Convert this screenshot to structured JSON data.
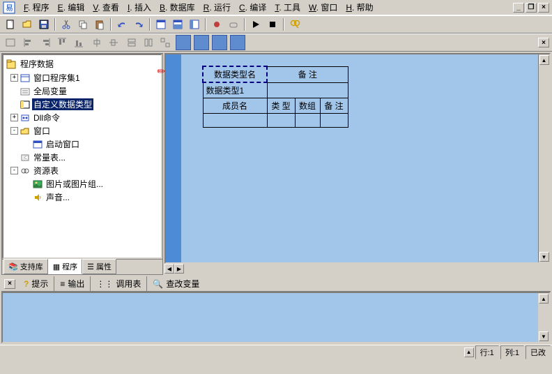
{
  "menu": {
    "items": [
      {
        "key": "F",
        "label": ". 程序"
      },
      {
        "key": "E",
        "label": ". 编辑"
      },
      {
        "key": "V",
        "label": ". 查看"
      },
      {
        "key": "I",
        "label": ". 插入"
      },
      {
        "key": "B",
        "label": ". 数据库"
      },
      {
        "key": "R",
        "label": ". 运行"
      },
      {
        "key": "C",
        "label": ". 编译"
      },
      {
        "key": "T",
        "label": ". 工具"
      },
      {
        "key": "W",
        "label": ". 窗口"
      },
      {
        "key": "H",
        "label": ". 帮助"
      }
    ]
  },
  "tree": {
    "title": "程序数据",
    "nodes": [
      {
        "exp": "+",
        "icon": "module",
        "label": "窗口程序集1"
      },
      {
        "exp": "",
        "icon": "global",
        "label": "全局变量"
      },
      {
        "exp": "",
        "icon": "type",
        "label": "自定义数据类型",
        "selected": true
      },
      {
        "exp": "+",
        "icon": "dll",
        "label": "Dll命令"
      },
      {
        "exp": "-",
        "icon": "folder",
        "label": "窗口"
      },
      {
        "exp": "",
        "icon": "window",
        "label": "启动窗口",
        "indent": 2
      },
      {
        "exp": "",
        "icon": "const",
        "label": "常量表..."
      },
      {
        "exp": "-",
        "icon": "res",
        "label": "资源表"
      },
      {
        "exp": "",
        "icon": "image",
        "label": "图片或图片组...",
        "indent": 2
      },
      {
        "exp": "",
        "icon": "sound",
        "label": "声音...",
        "indent": 2
      }
    ]
  },
  "left_tabs": {
    "items": [
      {
        "icon": "book",
        "label": "支持库"
      },
      {
        "icon": "prog",
        "label": "程序",
        "active": true
      },
      {
        "icon": "prop",
        "label": "属性"
      }
    ]
  },
  "grid": {
    "row1": {
      "c1": "数据类型名",
      "c2": "备 注"
    },
    "row2": {
      "c1": "数据类型1"
    },
    "row3": {
      "c1": "成员名",
      "c2": "类 型",
      "c3": "数组",
      "c4": "备 注"
    }
  },
  "bottom_tabs": {
    "items": [
      {
        "icon": "?",
        "label": "提示"
      },
      {
        "icon": "≡",
        "label": "输出"
      },
      {
        "icon": "⋮⋮",
        "label": "调用表"
      },
      {
        "icon": "Q",
        "label": "查改变量"
      }
    ]
  },
  "status": {
    "row": "行:1",
    "col": "列:1",
    "modified": "已改"
  }
}
